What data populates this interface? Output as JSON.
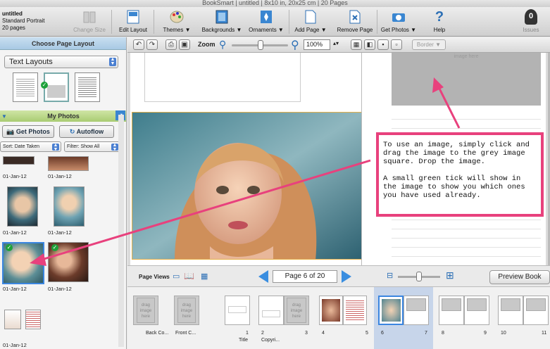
{
  "window": {
    "title": "BookSmart  |  untitled  |  8x10 in, 20x25 cm  |  20 Pages"
  },
  "project": {
    "name": "untitled",
    "format": "Standard Portrait",
    "pages": "20 pages"
  },
  "toolbar": {
    "change_size": "Change Size",
    "edit_layout": "Edit Layout",
    "themes": "Themes ▼",
    "backgrounds": "Backgrounds ▼",
    "ornaments": "Ornaments ▼",
    "add_page": "Add Page ▼",
    "remove_page": "Remove Page",
    "get_photos": "Get Photos ▼",
    "help": "Help",
    "issues": "Issues",
    "issues_count": "0"
  },
  "left": {
    "layout_header": "Choose Page Layout",
    "layout_select": "Text Layouts",
    "photos_header": "My Photos",
    "get_photos": "Get Photos",
    "autoflow": "Autoflow",
    "sort": "Sort:  Date Taken",
    "filter": "Filter: Show All",
    "dates": [
      "01-Jan-12",
      "01-Jan-12",
      "01-Jan-12",
      "01-Jan-12",
      "01-Jan-12",
      "01-Jan-12",
      "01-Jan-12"
    ]
  },
  "main": {
    "zoom_label": "Zoom",
    "zoom_value": "100%",
    "border": "Border ▼",
    "grey_placeholder": "image here"
  },
  "note": {
    "line1": "To use an image, simply click and drag the image to the grey image square.  Drop the image.",
    "line2": "A small green tick will show in the image to show you which ones you have used already."
  },
  "pageviews": {
    "label": "Page Views",
    "page": "Page 6 of 20",
    "preview": "Preview Book"
  },
  "film": {
    "placeholder": "drag image here",
    "labels": [
      "Back Co...",
      "Front C...",
      "Title",
      "Copyri..."
    ],
    "nums": [
      "1",
      "2",
      "3",
      "4",
      "5",
      "6",
      "7",
      "8",
      "9",
      "10",
      "11"
    ]
  },
  "colors": {
    "accent": "#e8417d",
    "tick": "#1ea13a",
    "select": "#4a7fd1"
  }
}
